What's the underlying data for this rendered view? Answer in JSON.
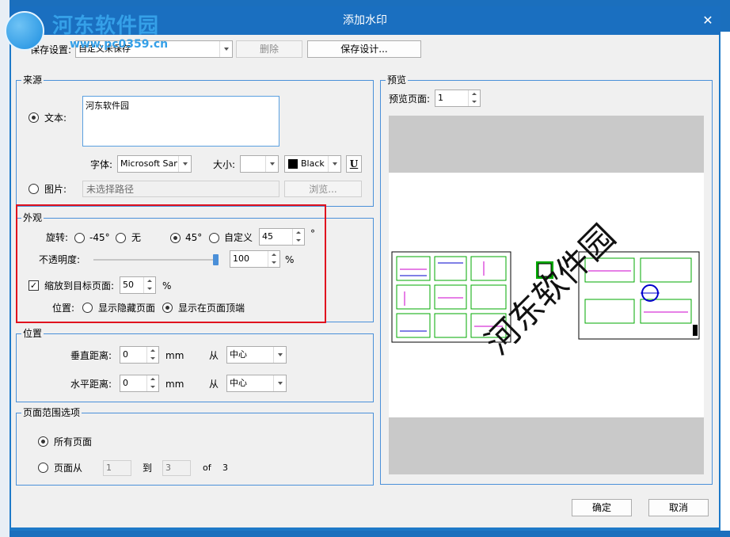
{
  "title": "添加水印",
  "logo": {
    "name": "河东软件园",
    "url": "www.pc0359.cn"
  },
  "top": {
    "save_settings_label": "保存设置:",
    "save_settings_value": "自定义未保存",
    "delete_label": "删除",
    "save_design_label": "保存设计..."
  },
  "source": {
    "title": "来源",
    "text_label": "文本:",
    "text_value": "河东软件园",
    "font_label": "字体:",
    "font_value": "Microsoft Sans",
    "size_label": "大小:",
    "size_value": "",
    "color_value": "Black",
    "underline": "U",
    "image_label": "图片:",
    "image_placeholder": "未选择路径",
    "browse_label": "浏览..."
  },
  "appearance": {
    "title": "外观",
    "rotation_label": "旋转:",
    "rot_m45": "-45°",
    "rot_none": "无",
    "rot_45": "45°",
    "rot_custom": "自定义",
    "rot_custom_value": "45",
    "degree_unit": "°",
    "opacity_label": "不透明度:",
    "opacity_value": "100",
    "opacity_slider_fraction": 1.0,
    "percent_unit": "%",
    "scale_label": "缩放到目标页面:",
    "scale_value": "50",
    "position_label": "位置:",
    "pos_hidden": "显示隐藏页面",
    "pos_top": "显示在页面顶端"
  },
  "position": {
    "title": "位置",
    "vertical_label": "垂直距离:",
    "vertical_value": "0",
    "horizontal_label": "水平距离:",
    "horizontal_value": "0",
    "unit": "mm",
    "from_label": "从",
    "from_value": "中心"
  },
  "page_range": {
    "title": "页面范围选项",
    "all_pages": "所有页面",
    "pages_from": "页面从",
    "from_value": "1",
    "to_label": "到",
    "to_value": "3",
    "of_label": "of",
    "of_value": "3"
  },
  "preview": {
    "title": "预览",
    "page_label": "预览页面:",
    "page_value": "1",
    "watermark_text": "河东软件园"
  },
  "footer": {
    "ok_label": "确定",
    "cancel_label": "取消"
  },
  "colors": {
    "accent": "#1e7ac8",
    "highlight": "#e0121e",
    "group_border": "#4a90d9"
  }
}
